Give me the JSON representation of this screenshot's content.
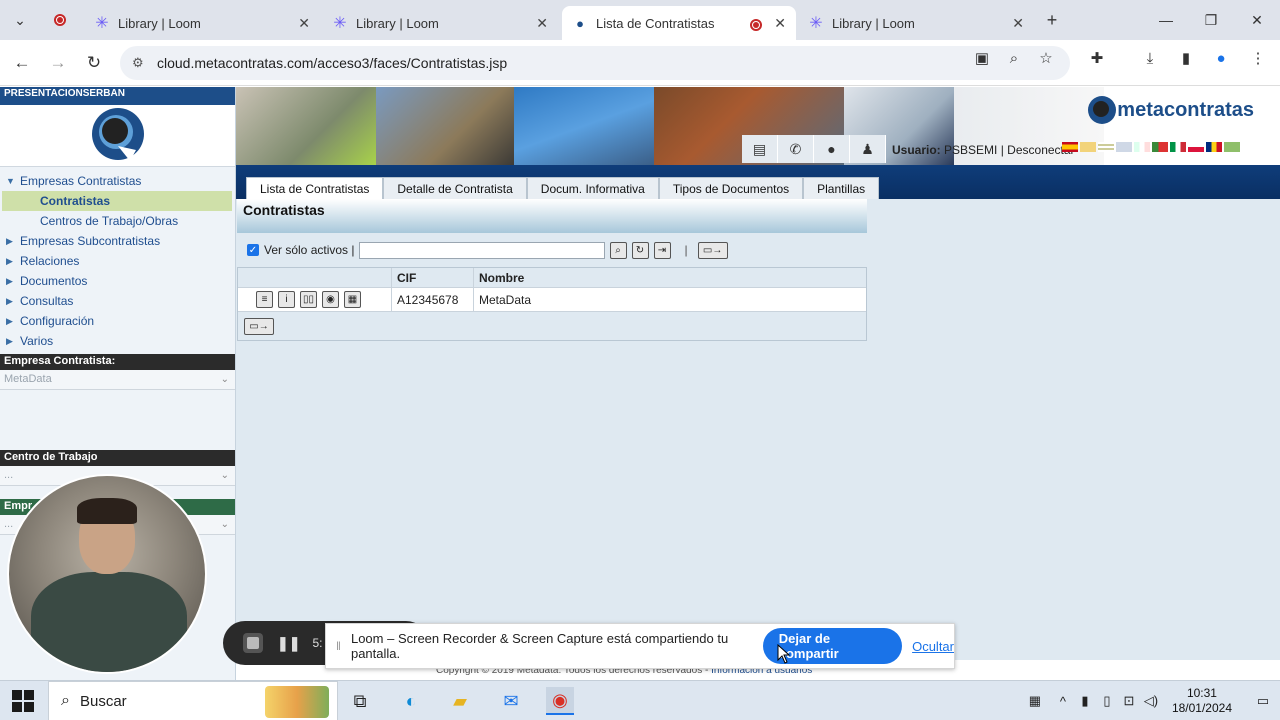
{
  "browser": {
    "tabs": [
      {
        "label": "Library | Loom",
        "active": false
      },
      {
        "label": "Library | Loom",
        "active": false
      },
      {
        "label": "Lista de Contratistas",
        "active": true
      },
      {
        "label": "Library | Loom",
        "active": false
      }
    ],
    "url": "cloud.metacontratas.com/acceso3/faces/Contratistas.jsp"
  },
  "sidebar": {
    "company": "PRESENTACIONSERBAN",
    "items": [
      {
        "label": "Empresas Contratistas",
        "expanded": true
      },
      {
        "label": "Contratistas",
        "child": true,
        "selected": true
      },
      {
        "label": "Centros de Trabajo/Obras",
        "child": true
      },
      {
        "label": "Empresas Subcontratistas"
      },
      {
        "label": "Relaciones"
      },
      {
        "label": "Documentos"
      },
      {
        "label": "Consultas"
      },
      {
        "label": "Configuración"
      },
      {
        "label": "Varios"
      }
    ],
    "empresa_header": "Empresa Contratista:",
    "empresa_value": "MetaData",
    "centro_header": "Centro de Trabajo",
    "centro_value": "...",
    "empr_header": "Empr",
    "empr_value": "..."
  },
  "header": {
    "brand": "metacontratas",
    "user_label": "Usuario:",
    "user_name": "PSBSEMI",
    "logout": "| Desconectar"
  },
  "menu": {
    "tabs": [
      "Lista de Contratistas",
      "Detalle de Contratista",
      "Docum. Informativa",
      "Tipos de Documentos",
      "Plantillas"
    ]
  },
  "content": {
    "title": "Contratistas",
    "filter_label": "Ver sólo activos |",
    "columns": [
      "CIF",
      "Nombre"
    ],
    "rows": [
      {
        "cif": "A12345678",
        "nombre": "MetaData"
      }
    ]
  },
  "footer": {
    "copyright": "Copyright © 2019 Metadata. Todos los derechos reservados -",
    "link": "Información a usuarios"
  },
  "loom": {
    "timer": "5:",
    "share_message": "Loom – Screen Recorder & Screen Capture está compartiendo tu pantalla.",
    "stop_share": "Dejar de compartir",
    "hide": "Ocultar"
  },
  "taskbar": {
    "search": "Buscar",
    "time": "10:31",
    "date": "18/01/2024"
  },
  "colors": {
    "brand_blue": "#1d4e89",
    "menu_blue": "#0f3d7a",
    "accent_blue": "#1a73e8",
    "selected_green": "#cfe0a9"
  }
}
